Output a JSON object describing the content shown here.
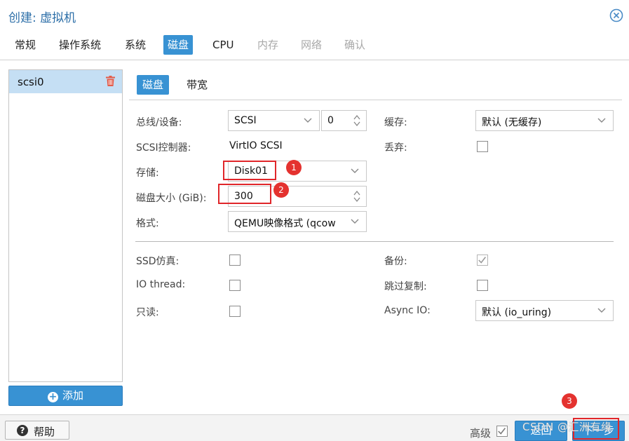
{
  "window": {
    "title": "创建: 虚拟机"
  },
  "tabs": [
    {
      "label": "常规"
    },
    {
      "label": "操作系统"
    },
    {
      "label": "系统"
    },
    {
      "label": "磁盘"
    },
    {
      "label": "CPU"
    },
    {
      "label": "内存"
    },
    {
      "label": "网络"
    },
    {
      "label": "确认"
    }
  ],
  "disk_list": {
    "items": [
      {
        "label": "scsi0"
      }
    ],
    "add_label": "添加"
  },
  "subtabs": [
    {
      "label": "磁盘"
    },
    {
      "label": "带宽"
    }
  ],
  "form": {
    "bus_label": "总线/设备:",
    "bus_value": "SCSI",
    "device_value": "0",
    "controller_label": "SCSI控制器:",
    "controller_value": "VirtIO SCSI",
    "storage_label": "存储:",
    "storage_value": "Disk01",
    "size_label": "磁盘大小 (GiB):",
    "size_value": "300",
    "format_label": "格式:",
    "format_value": "QEMU映像格式 (qcow",
    "cache_label": "缓存:",
    "cache_value": "默认 (无缓存)",
    "discard_label": "丢弃:",
    "discard_checked": false,
    "ssd_label": "SSD仿真:",
    "ssd_checked": false,
    "iothread_label": "IO thread:",
    "iothread_checked": false,
    "readonly_label": "只读:",
    "readonly_checked": false,
    "backup_label": "备份:",
    "backup_checked": true,
    "skip_replication_label": "跳过复制:",
    "skip_replication_checked": false,
    "async_io_label": "Async IO:",
    "async_io_value": "默认 (io_uring)"
  },
  "annotations": [
    {
      "number": "1"
    },
    {
      "number": "2"
    },
    {
      "number": "3"
    }
  ],
  "footer": {
    "help_label": "帮助",
    "advanced_label": "高级",
    "advanced_checked": true,
    "back_label": "返回",
    "next_label": "下一步",
    "watermark": "CSDN @汇洲有缘"
  },
  "colors": {
    "accent": "#3892d3",
    "title": "#2d6fa8",
    "annotation": "#e0262a"
  }
}
